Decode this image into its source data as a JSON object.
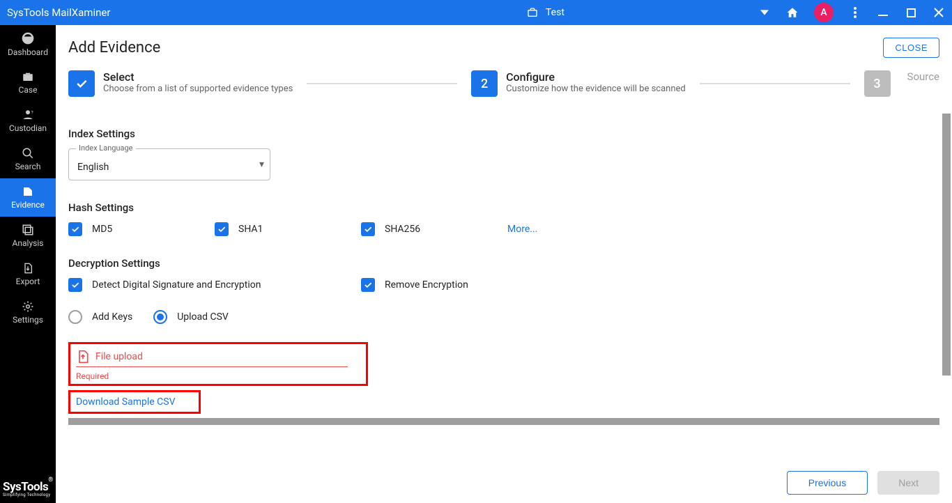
{
  "titlebar": {
    "app_name": "SysTools MailXaminer",
    "case_name": "Test",
    "avatar_letter": "A"
  },
  "sidebar": {
    "items": [
      {
        "label": "Dashboard"
      },
      {
        "label": "Case"
      },
      {
        "label": "Custodian"
      },
      {
        "label": "Search"
      },
      {
        "label": "Evidence"
      },
      {
        "label": "Analysis"
      },
      {
        "label": "Export"
      },
      {
        "label": "Settings"
      }
    ],
    "logo_brand": "SysTools",
    "logo_tagline": "Simplifying Technology"
  },
  "page": {
    "title": "Add Evidence",
    "close_label": "CLOSE"
  },
  "stepper": {
    "step1_title": "Select",
    "step1_sub": "Choose from a list of supported evidence types",
    "step2_num": "2",
    "step2_title": "Configure",
    "step2_sub": "Customize how the evidence will be scanned",
    "step3_num": "3",
    "step3_title": "Source"
  },
  "index_settings": {
    "heading": "Index Settings",
    "lang_float_label": "Index Language",
    "lang_value": "English"
  },
  "hash_settings": {
    "heading": "Hash Settings",
    "md5": "MD5",
    "sha1": "SHA1",
    "sha256": "SHA256",
    "more": "More..."
  },
  "decryption": {
    "heading": "Decryption Settings",
    "detect": "Detect Digital Signature and Encryption",
    "remove": "Remove Encryption",
    "add_keys": "Add Keys",
    "upload_csv": "Upload CSV"
  },
  "upload": {
    "file_upload": "File upload",
    "required": "Required",
    "download_sample": "Download Sample CSV"
  },
  "footer": {
    "prev": "Previous",
    "next": "Next"
  }
}
